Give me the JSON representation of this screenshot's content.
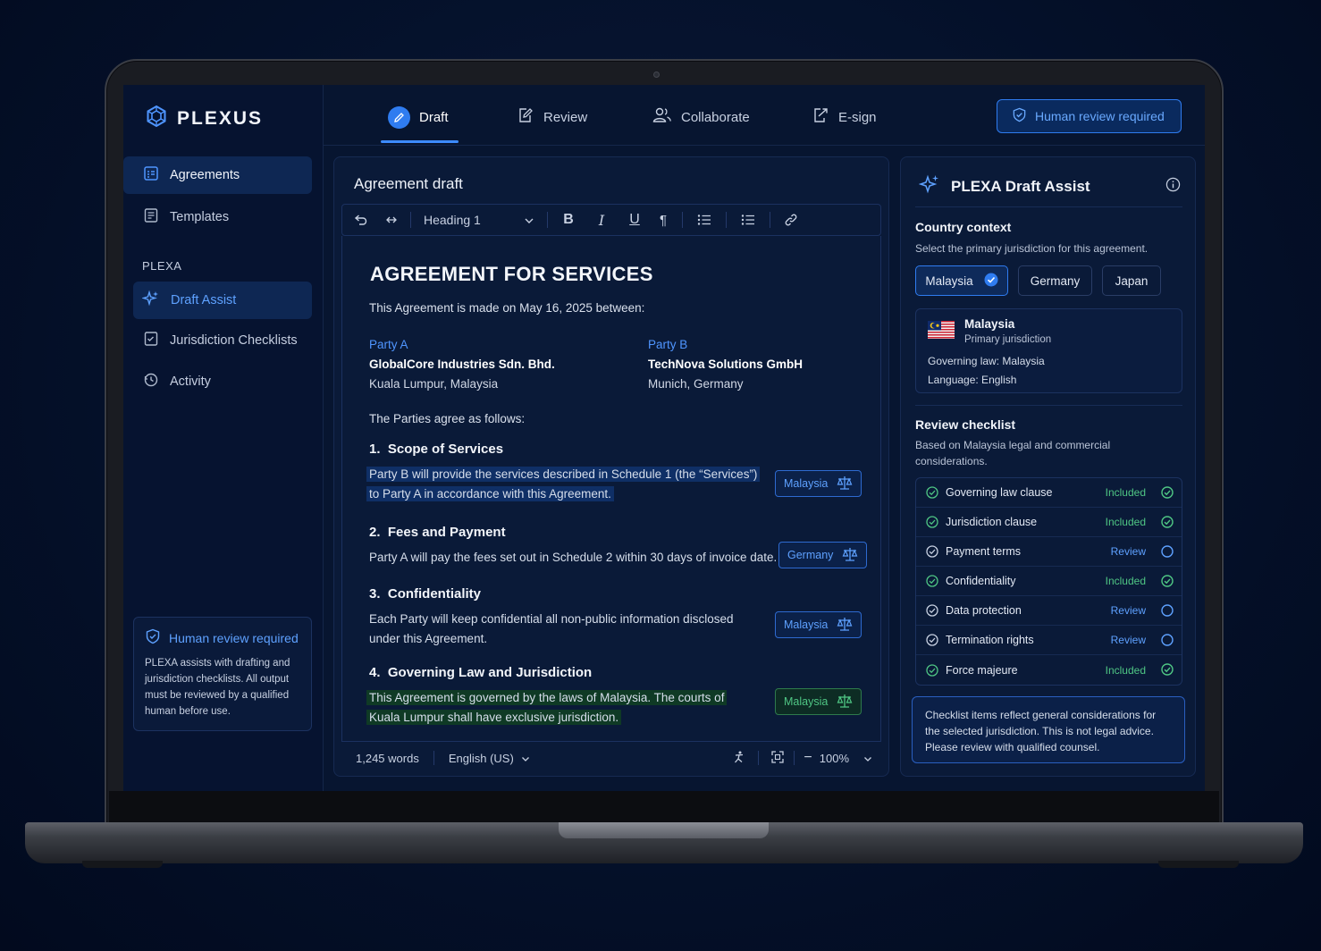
{
  "brand": {
    "name": "PLEXUS"
  },
  "topnav": {
    "tabs": [
      {
        "label": "Draft",
        "icon": "pencil-icon",
        "active": true
      },
      {
        "label": "Review",
        "icon": "edit-document-icon",
        "active": false
      },
      {
        "label": "Collaborate",
        "icon": "users-icon",
        "active": false
      },
      {
        "label": "E-sign",
        "icon": "sign-export-icon",
        "active": false
      }
    ],
    "review_button": "Human review required"
  },
  "sidebar": {
    "items": [
      {
        "label": "Agreements",
        "icon": "calendar-doc-icon",
        "active": true
      },
      {
        "label": "Templates",
        "icon": "template-icon",
        "active": false
      }
    ],
    "section_label": "PLEXA",
    "plexa_items": [
      {
        "label": "Draft Assist",
        "icon": "sparkle-icon",
        "active": true
      },
      {
        "label": "Jurisdiction Checklists",
        "icon": "checklist-icon",
        "active": false
      },
      {
        "label": "Activity",
        "icon": "history-icon",
        "active": false
      }
    ],
    "notice": {
      "title": "Human review required",
      "text": "PLEXA assists with drafting and jurisdiction checklists. All output must be reviewed by a qualified human before use."
    }
  },
  "editor": {
    "title": "Agreement draft",
    "toolbar": {
      "style_select": "Heading 1"
    },
    "doc": {
      "heading": "AGREEMENT FOR SERVICES",
      "intro": "This Agreement is made on May 16, 2025 between:",
      "party_a": {
        "label": "Party A",
        "name": "GlobalCore Industries Sdn. Bhd.",
        "location": "Kuala Lumpur, Malaysia"
      },
      "party_b": {
        "label": "Party B",
        "name": "TechNova Solutions GmbH",
        "location": "Munich, Germany"
      },
      "agree": "The Parties agree as follows:",
      "sections": [
        {
          "num": "1.",
          "title": "Scope of Services",
          "line1": "Party B will provide the services described in Schedule 1 (the “Services”)",
          "line2": "to Party A in accordance with this Agreement.",
          "tag": "Malaysia"
        },
        {
          "num": "2.",
          "title": "Fees and Payment",
          "line1": "Party A will pay the fees set out in Schedule 2 within 30 days of invoice date.",
          "line2": "",
          "tag": "Germany"
        },
        {
          "num": "3.",
          "title": "Confidentiality",
          "line1": "Each Party will keep confidential all non-public information disclosed",
          "line2": "under this Agreement.",
          "tag": "Malaysia"
        },
        {
          "num": "4.",
          "title": "Governing Law and Jurisdiction",
          "line1": "This Agreement is governed by the laws of Malaysia. The courts of",
          "line2": "Kuala Lumpur shall have exclusive jurisdiction.",
          "tag": "Malaysia"
        }
      ]
    },
    "status": {
      "words": "1,245 words",
      "language": "English (US)",
      "zoom": "100%"
    }
  },
  "assist": {
    "title": "PLEXA Draft Assist",
    "country_context": {
      "heading": "Country context",
      "sub": "Select the primary jurisdiction for this agreement.",
      "options": [
        "Malaysia",
        "Germany",
        "Japan"
      ],
      "selected": "Malaysia",
      "card": {
        "name": "Malaysia",
        "role": "Primary jurisdiction",
        "law": "Governing law: Malaysia",
        "language": "Language: English"
      }
    },
    "checklist": {
      "heading": "Review checklist",
      "sub": "Based on Malaysia legal and commercial considerations.",
      "items": [
        {
          "label": "Governing law clause",
          "status": "Included"
        },
        {
          "label": "Jurisdiction clause",
          "status": "Included"
        },
        {
          "label": "Payment terms",
          "status": "Review"
        },
        {
          "label": "Confidentiality",
          "status": "Included"
        },
        {
          "label": "Data protection",
          "status": "Review"
        },
        {
          "label": "Termination rights",
          "status": "Review"
        },
        {
          "label": "Force majeure",
          "status": "Included"
        }
      ]
    },
    "disclaimer": "Checklist items reflect general considerations for the selected jurisdiction. This is not legal advice. Please review with qualified counsel."
  },
  "colors": {
    "accent": "#2f7cf0",
    "included": "#4fc684",
    "review": "#5ea1ff",
    "background": "#071530"
  }
}
